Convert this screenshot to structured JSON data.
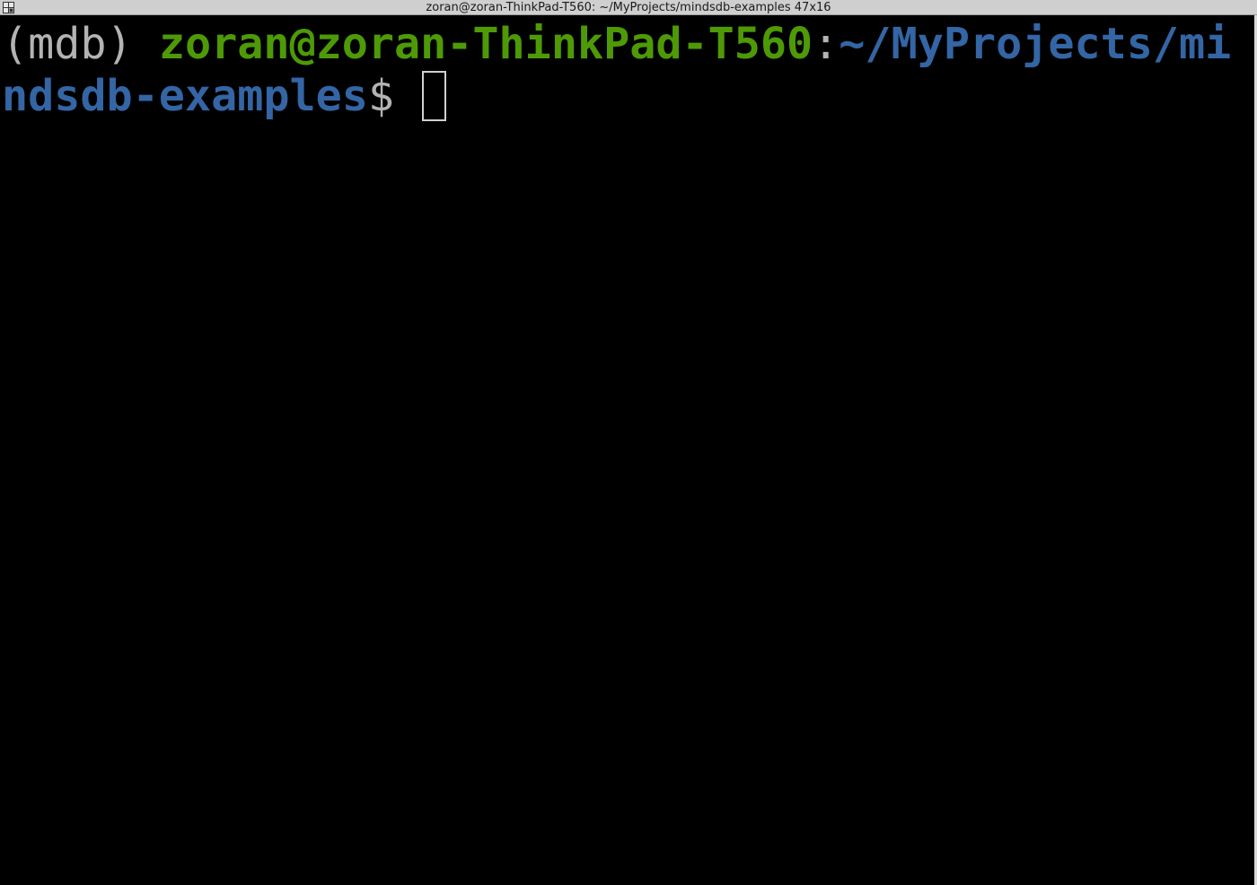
{
  "window": {
    "title": "zoran@zoran-ThinkPad-T560: ~/MyProjects/mindsdb-examples 47x16",
    "icon": "terminal-window-icon"
  },
  "terminal": {
    "prompt": {
      "venv": "(mdb)",
      "user_host": "zoran@zoran-ThinkPad-T560",
      "separator": ":",
      "path": "~/MyProjects/mindsdb-examples",
      "symbol": "$"
    },
    "input": ""
  },
  "colors": {
    "background": "#000000",
    "foreground": "#b3b3b3",
    "user_host": "#4e9a06",
    "path": "#3465a4",
    "titlebar": "#cfcfcf"
  }
}
